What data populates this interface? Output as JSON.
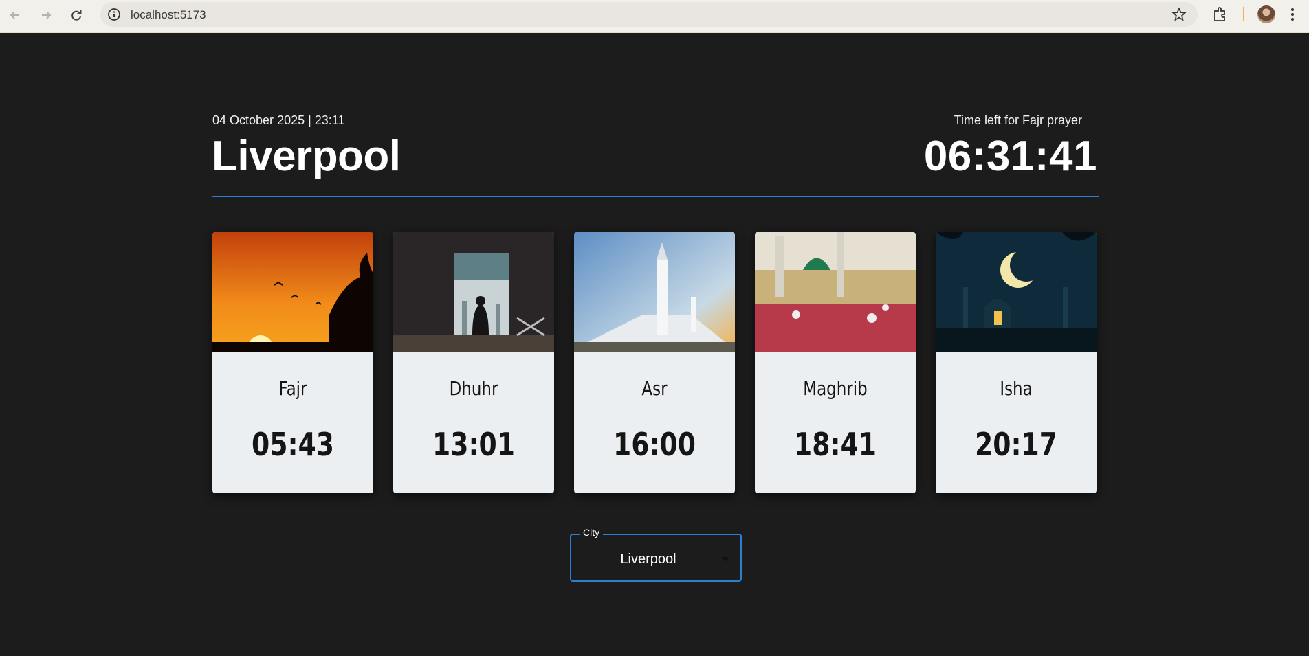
{
  "browser": {
    "url": "localhost:5173"
  },
  "header": {
    "datetime": "04 October 2025 | 23:11",
    "city": "Liverpool",
    "time_left_label": "Time left for Fajr prayer",
    "countdown": "06:31:41"
  },
  "prayers": [
    {
      "name": "Fajr",
      "time": "05:43",
      "image": "sunset-mosque-silhouette"
    },
    {
      "name": "Dhuhr",
      "time": "13:01",
      "image": "man-praying-window"
    },
    {
      "name": "Asr",
      "time": "16:00",
      "image": "white-mosque-minaret"
    },
    {
      "name": "Maghrib",
      "time": "18:41",
      "image": "mosque-courtyard-carpets"
    },
    {
      "name": "Isha",
      "time": "20:17",
      "image": "mosque-night-crescent"
    }
  ],
  "city_select": {
    "label": "City",
    "value": "Liverpool"
  },
  "colors": {
    "background": "#1c1c1c",
    "accent": "#2d7dd2",
    "card": "#eceff2"
  }
}
